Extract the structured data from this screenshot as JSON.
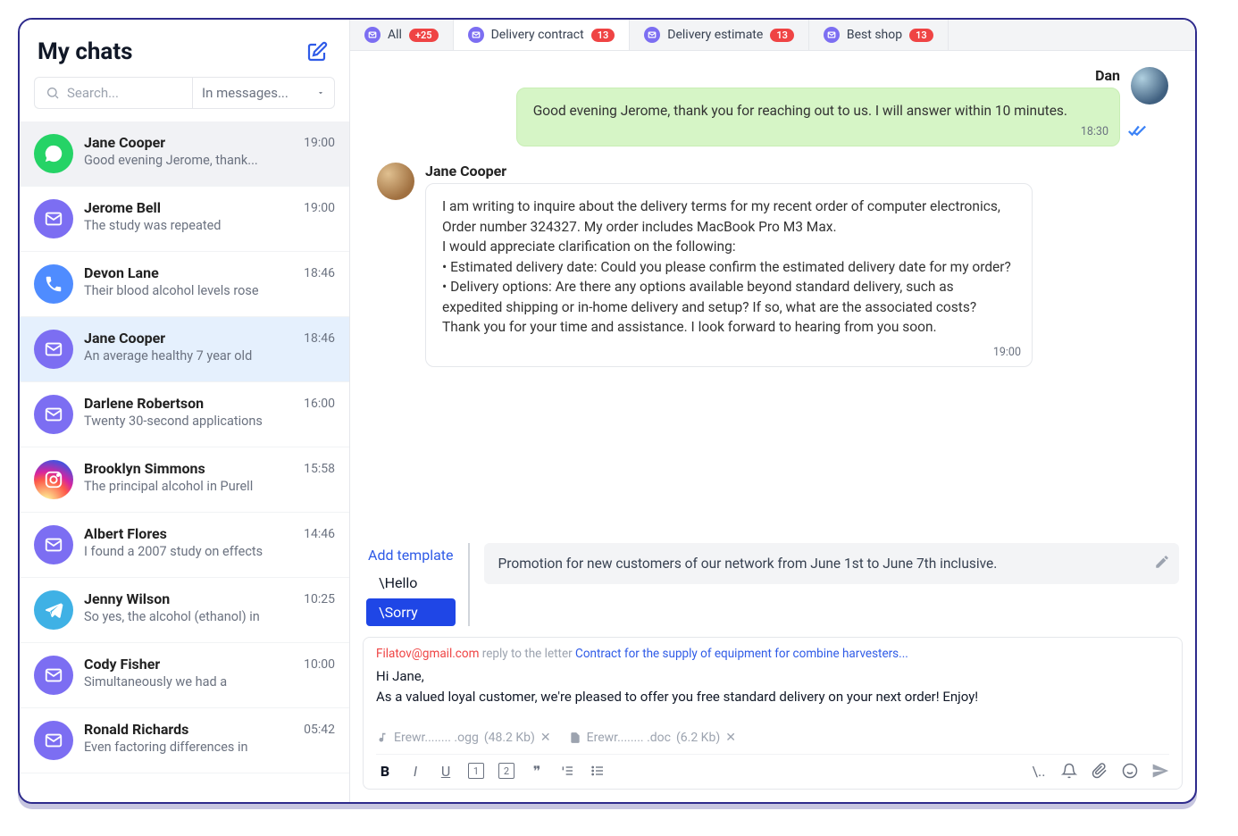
{
  "sidebar": {
    "title": "My chats",
    "search_placeholder": "Search...",
    "filter_label": "In messages...",
    "items": [
      {
        "name": "Jane Cooper",
        "preview": "Good evening Jerome, thank...",
        "time": "19:00",
        "channel": "whatsapp",
        "state": "active"
      },
      {
        "name": "Jerome Bell",
        "preview": "The study was repeated",
        "time": "19:00",
        "channel": "mail",
        "state": ""
      },
      {
        "name": "Devon Lane",
        "preview": "Their blood alcohol levels rose",
        "time": "18:46",
        "channel": "phone",
        "state": ""
      },
      {
        "name": "Jane Cooper",
        "preview": "An average healthy 7 year old",
        "time": "18:46",
        "channel": "mail",
        "state": "selected"
      },
      {
        "name": "Darlene Robertson",
        "preview": "Twenty 30-second applications",
        "time": "16:00",
        "channel": "mail",
        "state": ""
      },
      {
        "name": "Brooklyn Simmons",
        "preview": "The principal alcohol in Purell",
        "time": "15:58",
        "channel": "instagram",
        "state": ""
      },
      {
        "name": "Albert Flores",
        "preview": "I found a 2007 study on effects",
        "time": "14:46",
        "channel": "mail",
        "state": ""
      },
      {
        "name": "Jenny Wilson",
        "preview": "So yes, the alcohol (ethanol) in",
        "time": "10:25",
        "channel": "telegram",
        "state": ""
      },
      {
        "name": "Cody Fisher",
        "preview": "Simultaneously we had a",
        "time": "10:00",
        "channel": "mail",
        "state": ""
      },
      {
        "name": "Ronald Richards",
        "preview": "Even factoring differences in",
        "time": "05:42",
        "channel": "mail",
        "state": ""
      }
    ]
  },
  "tabs": [
    {
      "label": "All",
      "badge": "+25",
      "badge_style": "red",
      "active": false
    },
    {
      "label": "Delivery contract",
      "badge": "13",
      "badge_style": "red",
      "active": true
    },
    {
      "label": "Delivery estimate",
      "badge": "13",
      "badge_style": "red",
      "active": false
    },
    {
      "label": "Best shop",
      "badge": "13",
      "badge_style": "red",
      "active": false
    }
  ],
  "conversation": {
    "agent": {
      "name": "Dan",
      "message": "Good evening Jerome, thank you for reaching out to us. I will answer within 10 minutes.",
      "time": "18:30"
    },
    "customer": {
      "name": "Jane Cooper",
      "time": "19:00",
      "message": "I am writing to inquire about the delivery terms for my recent order of computer electronics, Order number 324327. My order includes MacBook Pro M3 Max.\nI would appreciate clarification on the following:\n• Estimated delivery date: Could you please confirm the estimated delivery date for my order?\n• Delivery options: Are there any options available beyond standard delivery, such as expedited shipping or in-home delivery and setup? If so, what are the associated costs?\nThank you for your time and assistance. I look forward to hearing from you soon."
    }
  },
  "templates": {
    "add_label": "Add template",
    "items": [
      "\\Hello",
      "\\Sorry"
    ],
    "selected": 1,
    "preview": "Promotion for new customers of our network from June 1st to June 7th inclusive."
  },
  "composer": {
    "reply_email": "Filatov@gmail.com",
    "reply_mid": " reply to the letter ",
    "reply_link": "Contract for the supply of equipment for combine harvesters...",
    "body": "Hi Jane,\nAs a valued loyal customer, we're pleased to offer you free standard delivery on your next order! Enjoy!",
    "attachments": [
      {
        "name": "Erewr........ .ogg",
        "size": "(48.2 Kb)"
      },
      {
        "name": "Erewr........ .doc",
        "size": "(6.2 Kb)"
      }
    ]
  }
}
